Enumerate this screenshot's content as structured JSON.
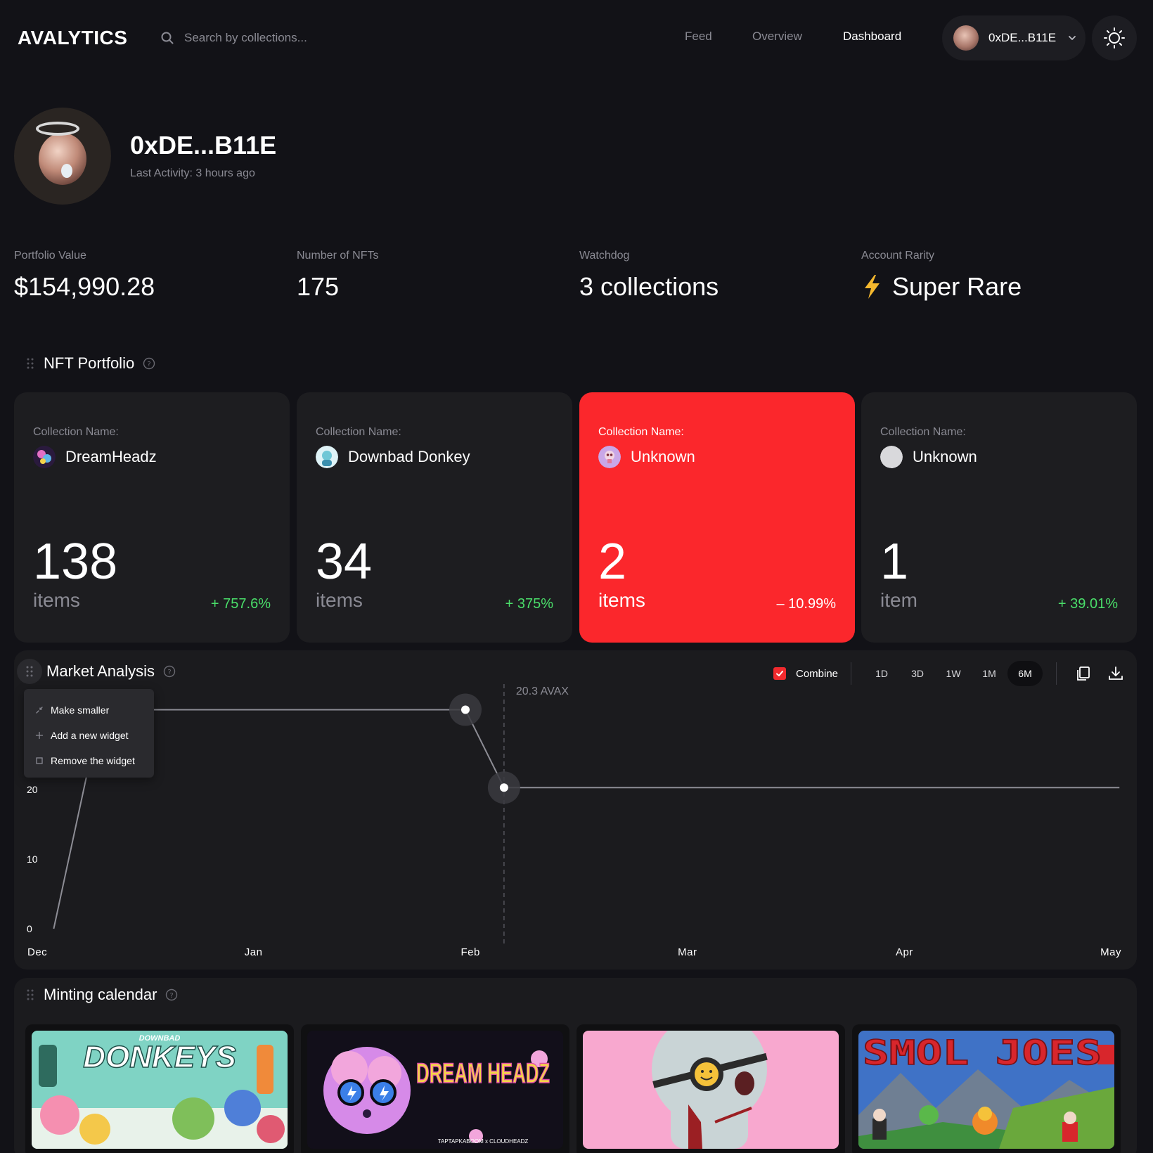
{
  "header": {
    "logo": "AVALYTICS",
    "search_placeholder": "Search by collections...",
    "nav": [
      {
        "label": "Feed",
        "active": false
      },
      {
        "label": "Overview",
        "active": false
      },
      {
        "label": "Dashboard",
        "active": true
      }
    ],
    "wallet_label": "0xDE...B11E"
  },
  "profile": {
    "name": "0xDE...B11E",
    "last_activity": "Last Activity: 3 hours ago"
  },
  "stats": [
    {
      "label": "Portfolio Value",
      "value": "$154,990.28"
    },
    {
      "label": "Number of NFTs",
      "value": "175"
    },
    {
      "label": "Watchdog",
      "value": "3 collections"
    },
    {
      "label": "Account Rarity",
      "value": "Super Rare",
      "icon": "lightning-icon"
    }
  ],
  "nft_portfolio": {
    "title": "NFT Portfolio",
    "cards": [
      {
        "label": "Collection Name:",
        "name": "DreamHeadz",
        "count": "138",
        "unit": "items",
        "change": "+ 757.6%",
        "highlight": false
      },
      {
        "label": "Collection Name:",
        "name": "Downbad Donkey",
        "count": "34",
        "unit": "items",
        "change": "+ 375%",
        "highlight": false
      },
      {
        "label": "Collection Name:",
        "name": "Unknown",
        "count": "2",
        "unit": "items",
        "change": "– 10.99%",
        "highlight": true
      },
      {
        "label": "Collection Name:",
        "name": "Unknown",
        "count": "1",
        "unit": "item",
        "change": "+ 39.01%",
        "highlight": false
      }
    ]
  },
  "market_analysis": {
    "title": "Market Analysis",
    "combine_label": "Combine",
    "combine_checked": true,
    "ranges": [
      "1D",
      "3D",
      "1W",
      "1M",
      "6M"
    ],
    "active_range": "6M",
    "context_menu": [
      "Make smaller",
      "Add a new widget",
      "Remove the widget"
    ]
  },
  "chart_data": {
    "type": "line",
    "title": "",
    "xlabel": "",
    "ylabel": "",
    "x_ticks": [
      "Dec",
      "Jan",
      "Feb",
      "Mar",
      "Apr",
      "May"
    ],
    "y_ticks": [
      "0",
      "10",
      "20"
    ],
    "ylim": [
      0,
      36
    ],
    "tooltip_label": "20.3 AVAX",
    "grid": false,
    "series": [
      {
        "points": [
          {
            "x": 0.08,
            "y": 0
          },
          {
            "x": 0.3,
            "y": 31.5
          },
          {
            "x": 2.0,
            "y": 31.5
          },
          {
            "x": 2.18,
            "y": 20.3
          },
          {
            "x": 5.05,
            "y": 20.3
          }
        ]
      }
    ],
    "markers": [
      {
        "x": 2.0,
        "y": 31.5
      },
      {
        "x": 2.18,
        "y": 20.3
      }
    ],
    "hover_x": 2.18
  },
  "minting_calendar": {
    "title": "Minting calendar",
    "banners": [
      {
        "text": "DONKEYS",
        "subtext": "DOWNBAD"
      },
      {
        "text": "DREAM HEADZ",
        "subtext": "TAPTAPKABOOM x CLOUDHEADZ"
      },
      {
        "text": ""
      },
      {
        "text": "SMOL JOES"
      }
    ]
  },
  "colors": {
    "background": "#121217",
    "card": "#1d1d20",
    "accent_red": "#fb272c",
    "positive_green": "#4ade6a",
    "muted_text": "#8a8a93"
  }
}
